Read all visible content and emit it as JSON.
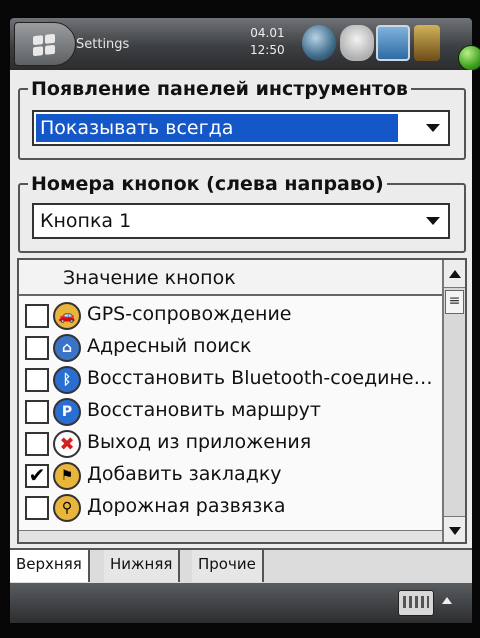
{
  "titlebar": {
    "app_title": "Settings",
    "clock_date": "04.01",
    "clock_time": "12:50"
  },
  "toolbar_group": {
    "legend": "Появление панелей инструментов",
    "selected": "Показывать всегда"
  },
  "buttons_group": {
    "legend": "Номера кнопок (слева направо)",
    "selected": "Кнопка 1"
  },
  "list": {
    "header": "Значение кнопок",
    "items": [
      {
        "label": "GPS-сопровождение",
        "checked": false,
        "icon": "car-icon",
        "icon_color": "#e9b53a"
      },
      {
        "label": "Адресный поиск",
        "checked": false,
        "icon": "address-search-icon",
        "icon_color": "#3b73c6"
      },
      {
        "label": "Восстановить Bluetooth-соедине…",
        "checked": false,
        "icon": "bluetooth-icon",
        "icon_color": "#2a6ed1"
      },
      {
        "label": "Восстановить маршрут",
        "checked": false,
        "icon": "route-icon",
        "icon_color": "#2a6ed1"
      },
      {
        "label": "Выход из приложения",
        "checked": false,
        "icon": "exit-icon",
        "icon_color": "#d42020"
      },
      {
        "label": "Добавить закладку",
        "checked": true,
        "icon": "bookmark-icon",
        "icon_color": "#e9b53a"
      },
      {
        "label": "Дорожная развязка",
        "checked": false,
        "icon": "zoom-icon",
        "icon_color": "#e9b53a"
      }
    ],
    "check_mark": "✔",
    "thumb_glyph": "≡"
  },
  "tabs": [
    {
      "label": "Верхняя",
      "active": true
    },
    {
      "label": "Нижняя",
      "active": false
    },
    {
      "label": "Прочие",
      "active": false
    }
  ]
}
